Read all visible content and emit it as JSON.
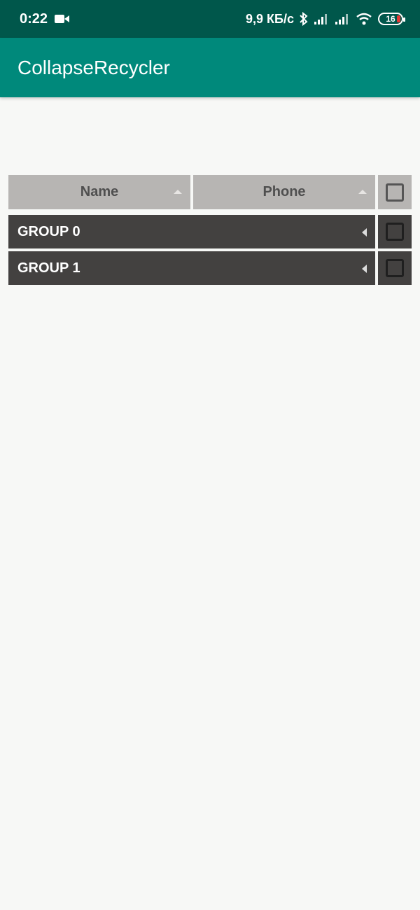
{
  "status_bar": {
    "time": "0:22",
    "net_speed": "9,9 КБ/с",
    "battery": "16",
    "icons": [
      "video-camera-icon",
      "bluetooth-icon",
      "signal-icon",
      "signal-icon",
      "wifi-icon",
      "battery-icon"
    ]
  },
  "app_bar": {
    "title": "CollapseRecycler"
  },
  "table": {
    "headers": {
      "name": "Name",
      "phone": "Phone"
    },
    "groups": [
      {
        "label": "GROUP 0",
        "checked": false
      },
      {
        "label": "GROUP 1",
        "checked": false
      }
    ]
  },
  "colors": {
    "status_bar": "#00574b",
    "app_bar": "#00897b",
    "header_cell": "#b7b5b3",
    "group_cell": "#434140",
    "background": "#f7f8f6"
  }
}
